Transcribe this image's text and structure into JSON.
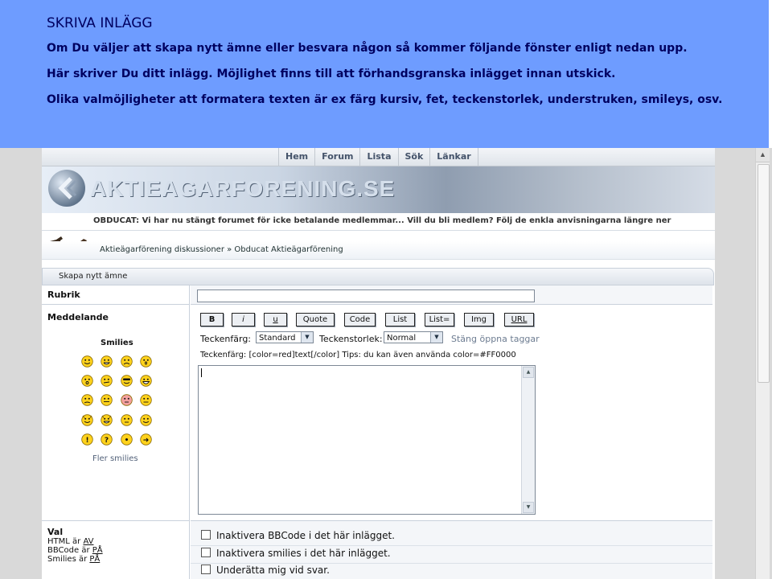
{
  "intro": {
    "title": "SKRIVA INLÄGG",
    "lines": [
      "Om Du väljer att skapa nytt ämne eller besvara någon så kommer följande fönster enligt nedan upp.",
      "Här skriver Du ditt inlägg. Möjlighet finns till att förhandsgranska inlägget innan utskick.",
      "Olika valmöjligheter att formatera texten är ex färg kursiv, fet, teckenstorlek, understruken, smileys, osv."
    ]
  },
  "site": {
    "nav": [
      "Hem",
      "Forum",
      "Lista",
      "Sök",
      "Länkar"
    ],
    "logo_text": "AKTIEAGARFORENING.SE",
    "ticker": "OBDUCAT: Vi har nu stängt forumet för icke betalande medlemmar... Vill du bli medlem? Följ de enkla anvisningarna längre ner",
    "breadcrumb": "Aktieägarförening diskussioner » Obducat Aktieägarförening"
  },
  "form": {
    "section_title": "Skapa nytt ämne",
    "rubrik_label": "Rubrik",
    "rubrik_value": "",
    "meddelande_label": "Meddelande",
    "smilies_title": "Smilies",
    "fler_smilies": "Fler smilies",
    "bbcode_buttons": [
      "B",
      "i",
      "u",
      "Quote",
      "Code",
      "List",
      "List=",
      "Img",
      "URL"
    ],
    "color_label": "Teckenfärg:",
    "color_value": "Standard",
    "size_label": "Teckenstorlek:",
    "size_value": "Normal",
    "close_tags": "Stäng öppna taggar",
    "help_text": "Teckenfärg: [color=red]text[/color]  Tips: du kan även använda color=#FF0000",
    "message_value": ""
  },
  "val": {
    "title": "Val",
    "html_prefix": "HTML är ",
    "html_value": "AV",
    "bbcode_prefix": "BBCode är ",
    "bbcode_value": "PÅ",
    "smilies_prefix": "Smilies är ",
    "smilies_value": "PÅ",
    "options": [
      "Inaktivera BBCode i det här inlägget.",
      "Inaktivera smilies i det här inlägget.",
      "Underätta mig vid svar."
    ]
  },
  "colors": {
    "intro_bg": "#6e9cff",
    "intro_text": "#000060",
    "smiley_yellow": "#ffd21c"
  }
}
